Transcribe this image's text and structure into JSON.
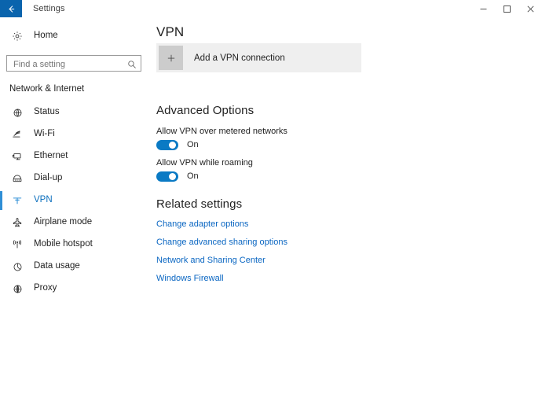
{
  "window": {
    "title": "Settings",
    "back_icon": "back-arrow-icon",
    "controls": {
      "minimize": "minimize-icon",
      "maximize": "maximize-icon",
      "close": "close-icon"
    }
  },
  "sidebar": {
    "home": {
      "label": "Home",
      "icon": "gear-icon"
    },
    "search": {
      "placeholder": "Find a setting",
      "value": "",
      "icon": "search-icon"
    },
    "category": "Network & Internet",
    "items": [
      {
        "label": "Status",
        "icon": "status-globe-icon",
        "selected": false
      },
      {
        "label": "Wi-Fi",
        "icon": "wifi-icon",
        "selected": false
      },
      {
        "label": "Ethernet",
        "icon": "ethernet-icon",
        "selected": false
      },
      {
        "label": "Dial-up",
        "icon": "dialup-modem-icon",
        "selected": false
      },
      {
        "label": "VPN",
        "icon": "vpn-key-icon",
        "selected": true
      },
      {
        "label": "Airplane mode",
        "icon": "airplane-icon",
        "selected": false
      },
      {
        "label": "Mobile hotspot",
        "icon": "hotspot-antenna-icon",
        "selected": false
      },
      {
        "label": "Data usage",
        "icon": "pie-chart-icon",
        "selected": false
      },
      {
        "label": "Proxy",
        "icon": "globe-icon",
        "selected": false
      }
    ]
  },
  "main": {
    "page_title": "VPN",
    "add_connection": {
      "label": "Add a VPN connection",
      "icon": "plus-icon"
    },
    "advanced_options": {
      "heading": "Advanced Options",
      "settings": [
        {
          "label": "Allow VPN over metered networks",
          "state": "On",
          "on": true
        },
        {
          "label": "Allow VPN while roaming",
          "state": "On",
          "on": true
        }
      ]
    },
    "related_settings": {
      "heading": "Related settings",
      "links": [
        "Change adapter options",
        "Change advanced sharing options",
        "Network and Sharing Center",
        "Windows Firewall"
      ]
    }
  },
  "colors": {
    "accent": "#0a7ac4",
    "titlebar_back": "#0a64ad",
    "link": "#0a66c2",
    "tile_bg": "#efefef",
    "plus_bg": "#cccccc"
  }
}
